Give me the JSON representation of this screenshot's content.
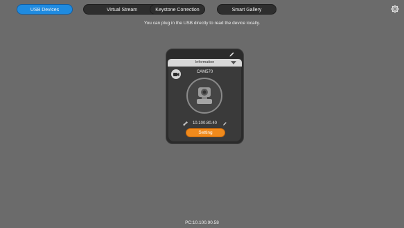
{
  "tabs": [
    {
      "label": "USB Devices",
      "active": true
    },
    {
      "label": "Virtual Stream",
      "active": false
    },
    {
      "label": "Keystone Correction",
      "active": false
    },
    {
      "label": "Smart Gallery",
      "active": false
    }
  ],
  "hint_text": "You can plug in the USB directly to read the device locally.",
  "device": {
    "info_label": "Information",
    "name": "CAM570",
    "ip": "10.100.80.40",
    "setting_label": "Setting"
  },
  "footer": {
    "pc_ip": "PC:10.100.90.58"
  },
  "icons": {
    "settings": "gear-icon",
    "card_edit": "pencil-icon",
    "dropdown": "chevron-down-icon",
    "camera_type": "video-camera-icon",
    "device_image": "ptz-camera-icon",
    "ip_link": "link-icon",
    "ip_edit": "pencil-icon"
  },
  "colors": {
    "background": "#6b6b6b",
    "active_tab": "#1f8be0",
    "setting_button": "#f08a1c"
  }
}
